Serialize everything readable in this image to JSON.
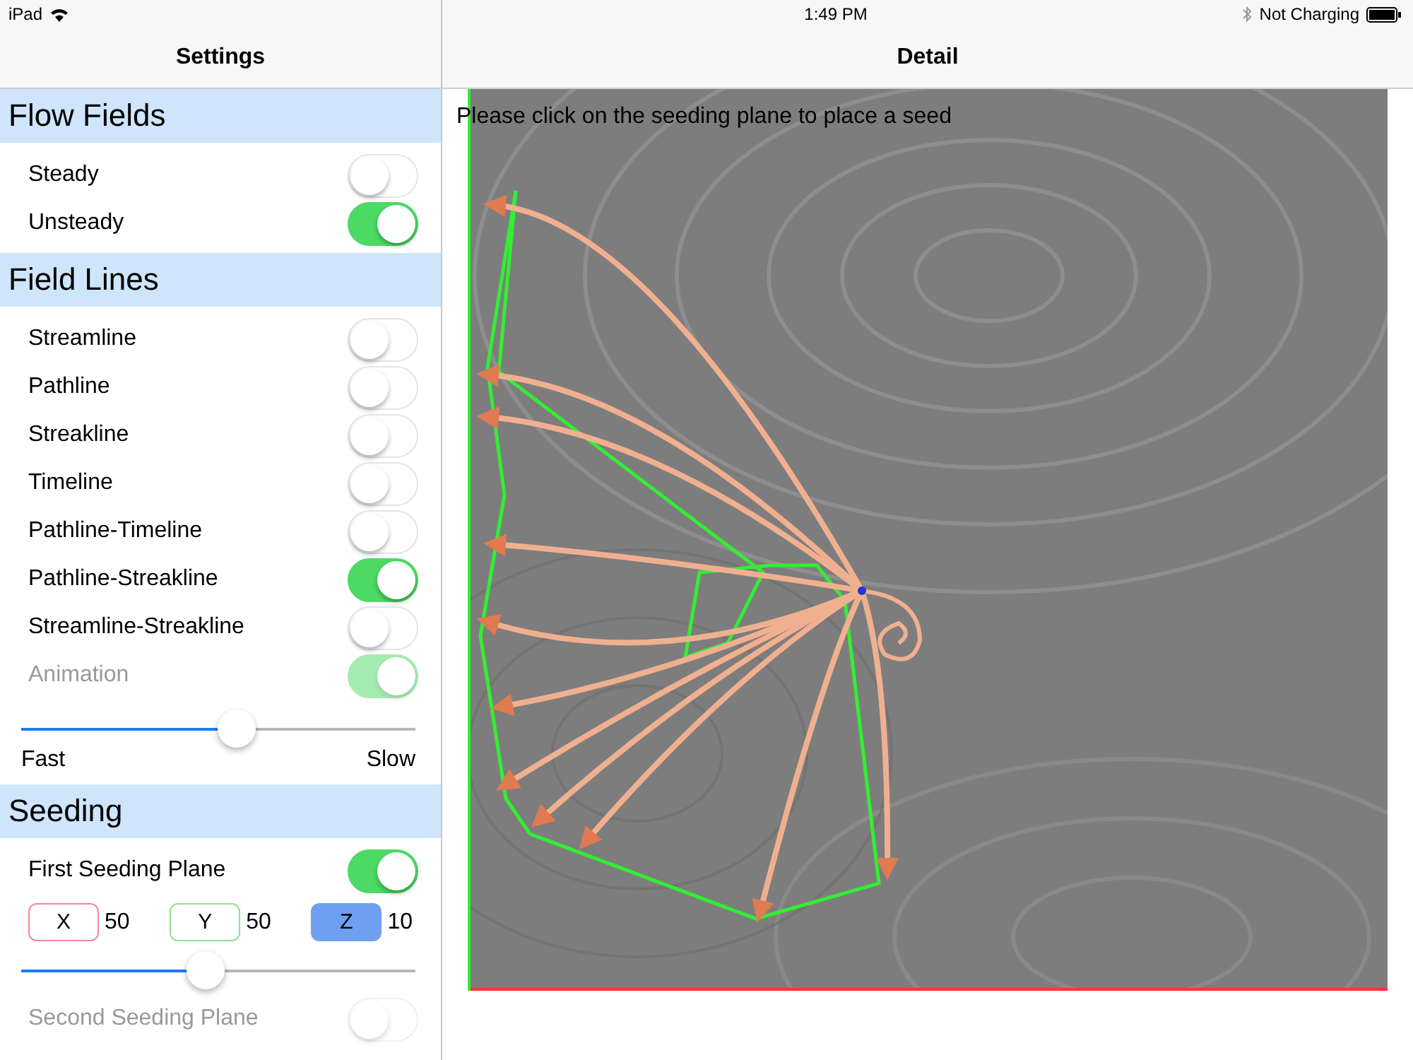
{
  "status_bar": {
    "device": "iPad",
    "time": "1:49 PM",
    "battery_text": "Not Charging"
  },
  "master": {
    "title": "Settings",
    "sections": [
      {
        "title": "Flow Fields",
        "rows": [
          {
            "kind": "toggle",
            "label": "Steady",
            "on": false,
            "disabled": false
          },
          {
            "kind": "toggle",
            "label": "Unsteady",
            "on": true,
            "disabled": false
          }
        ]
      },
      {
        "title": "Field Lines",
        "rows": [
          {
            "kind": "toggle",
            "label": "Streamline",
            "on": false,
            "disabled": false
          },
          {
            "kind": "toggle",
            "label": "Pathline",
            "on": false,
            "disabled": false
          },
          {
            "kind": "toggle",
            "label": "Streakline",
            "on": false,
            "disabled": false
          },
          {
            "kind": "toggle",
            "label": "Timeline",
            "on": false,
            "disabled": false
          },
          {
            "kind": "toggle",
            "label": "Pathline-Timeline",
            "on": false,
            "disabled": false
          },
          {
            "kind": "toggle",
            "label": "Pathline-Streakline",
            "on": true,
            "disabled": false
          },
          {
            "kind": "toggle",
            "label": "Streamline-Streakline",
            "on": false,
            "disabled": false
          },
          {
            "kind": "toggle",
            "label": "Animation",
            "on": true,
            "disabled": true
          },
          {
            "kind": "slider",
            "level": 0.55,
            "min_label": "Fast",
            "max_label": "Slow"
          }
        ]
      },
      {
        "title": "Seeding",
        "rows": [
          {
            "kind": "toggle",
            "label": "First Seeding Plane",
            "on": true,
            "disabled": false
          },
          {
            "kind": "axes",
            "axes": [
              {
                "label": "X",
                "value": "50",
                "color": "#f08a96",
                "selected": false
              },
              {
                "label": "Y",
                "value": "50",
                "color": "#8fe08f",
                "selected": false
              },
              {
                "label": "Z",
                "value": "10",
                "color": "#6f9ff0",
                "selected": true
              }
            ]
          },
          {
            "kind": "slider",
            "level": 0.47
          },
          {
            "kind": "toggle",
            "label": "Second Seeding Plane",
            "on": false,
            "disabled": true
          }
        ]
      }
    ]
  },
  "detail": {
    "title": "Detail",
    "hint": "Please click on the seeding plane to place a seed"
  }
}
